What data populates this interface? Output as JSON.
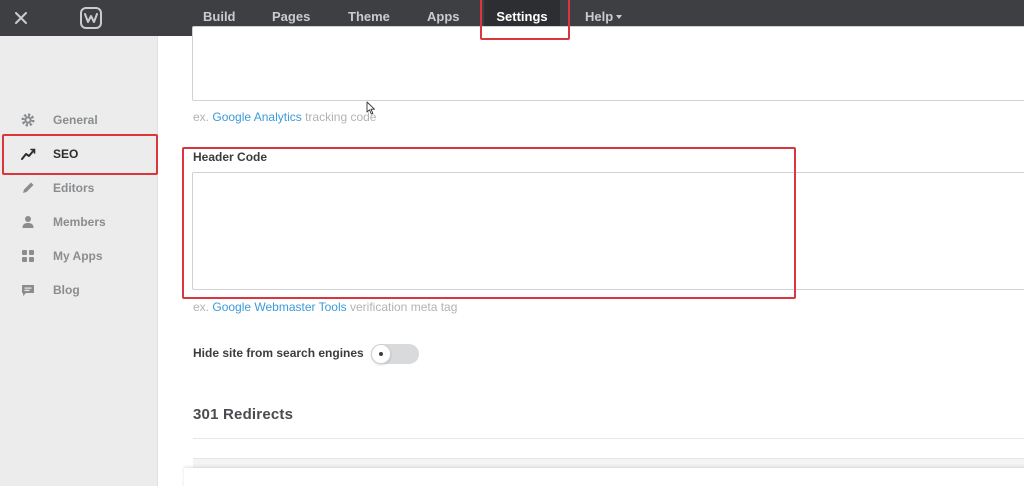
{
  "topbar": {
    "logo": "weebly-logo-icon",
    "close_icon": "close-icon",
    "nav": [
      {
        "label": "Build"
      },
      {
        "label": "Pages"
      },
      {
        "label": "Theme"
      },
      {
        "label": "Apps"
      },
      {
        "label": "Settings",
        "active": true
      },
      {
        "label": "Help",
        "has_dropdown": true
      }
    ],
    "bg_color": "#3d3f43",
    "active_bg_color": "#2c2e31"
  },
  "sidebar": {
    "items": [
      {
        "label": "General",
        "icon": "gear-icon"
      },
      {
        "label": "SEO",
        "icon": "trend-line-icon",
        "active": true
      },
      {
        "label": "Editors",
        "icon": "pencil-icon"
      },
      {
        "label": "Members",
        "icon": "person-icon"
      },
      {
        "label": "My Apps",
        "icon": "apps-grid-icon"
      },
      {
        "label": "Blog",
        "icon": "comment-icon"
      }
    ]
  },
  "main": {
    "footer_code": {
      "value": "",
      "hint_prefix": "ex.",
      "hint_link": "Google Analytics",
      "hint_suffix": "tracking code"
    },
    "header_code": {
      "label": "Header Code",
      "value": "",
      "hint_prefix": "ex.",
      "hint_link": "Google Webmaster Tools",
      "hint_suffix": "verification meta tag"
    },
    "hide_site": {
      "label": "Hide site from search engines",
      "enabled": false
    },
    "redirects": {
      "title": "301 Redirects"
    }
  },
  "colors": {
    "accent_link": "#3b9bd9",
    "highlight_red": "#d9363e",
    "sidebar_bg": "#ececec"
  }
}
